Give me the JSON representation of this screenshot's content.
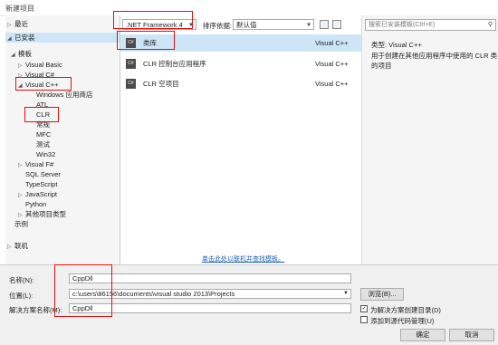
{
  "window": {
    "title": "新建项目"
  },
  "tree": {
    "recent": "最近",
    "installed": "已安装",
    "templates": "模板",
    "items": [
      "Visual Basic",
      "Visual C#",
      "Visual C++",
      "Windows 应用商店",
      "ATL",
      "CLR",
      "常规",
      "MFC",
      "测试",
      "Win32",
      "Visual F#",
      "SQL Server",
      "TypeScript",
      "JavaScript",
      "Python",
      "其他项目类型"
    ],
    "samples": "示例",
    "online": "联机"
  },
  "toolbar": {
    "framework": ".NET Framework 4",
    "sort_label": "排序依据:",
    "sort_value": "默认值"
  },
  "templates_list": [
    {
      "name": "类库",
      "lang": "Visual C++",
      "icon": "C#"
    },
    {
      "name": "CLR 控制台应用程序",
      "lang": "Visual C++",
      "icon": "C#"
    },
    {
      "name": "CLR 空项目",
      "lang": "Visual C++",
      "icon": "C#"
    }
  ],
  "online_link": "单击此处以联机并查找模板。",
  "search": {
    "placeholder": "搜索已安装模板(Ctrl+E)"
  },
  "description": {
    "type_label": "类型: Visual C++",
    "text_line1": "用于创建在其他应用程序中使用的 CLR 类",
    "text_line2": "的项目"
  },
  "form": {
    "name_label": "名称(N):",
    "name_value": "CppDll",
    "location_label": "位置(L):",
    "location_value": "c:\\users\\86156\\documents\\visual studio 2013\\Projects",
    "solution_label": "解决方案名称(M):",
    "solution_value": "CppDll",
    "browse_button": "浏览(B)...",
    "create_dir_label": "为解决方案创建目录(D)",
    "add_source_control_label": "添加到源代码管理(U)",
    "ok_button": "确定",
    "cancel_button": "取消"
  }
}
